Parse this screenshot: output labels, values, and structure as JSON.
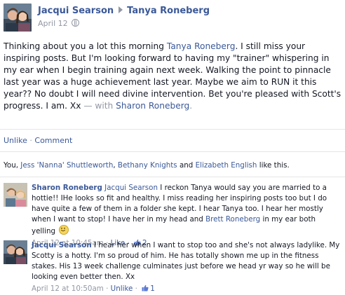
{
  "post": {
    "author": "Jacqui Searson",
    "target": "Tanya Roneberg",
    "date": "April 12",
    "privacy_icon": "globe-icon",
    "text_intro": "Thinking about you a lot this morning ",
    "text_mention": "Tanya Roneberg",
    "text_body": ". I still miss your inspiring posts. But I'm looking forward to having my \"trainer\" whispering in my ear when I begin training again next week. Walking the point to pinnacle last year was a huge achievement last year. Maybe we aim to RUN it this year?? No doubt I will need divine intervention. Bet you're pleased with Scott's progress. I am. Xx",
    "with_text": " — with ",
    "with_name": "Sharon Roneberg",
    "with_end": "."
  },
  "actions": {
    "unlike": "Unlike",
    "separator": "·",
    "comment": "Comment"
  },
  "likes": {
    "prefix": "You, ",
    "name1": "Jess 'Nanna' Shuttleworth",
    "sep1": ", ",
    "name2": "Bethany Knights",
    "and": " and ",
    "name3": "Elizabeth English",
    "suffix": " like this."
  },
  "comments": [
    {
      "author": "Sharon Roneberg",
      "mention1": "Jacqui Searson",
      "text1": " I reckon Tanya would say you are married to a hottie!! IHe looks so fit and healthy. I miss reading her inspiring posts too but I do have quite a few of them in a folder she kept. I hear Tanya too. I hear her mostly when I want to stop! I have her in my head and ",
      "mention2": "Brett Roneberg",
      "text2": " in my ear both yelling ",
      "time": "April 12 at 10:45am",
      "action": "Like",
      "like_count": "2",
      "emoji": "smiley-emoji"
    },
    {
      "author": "Jacqui Searson",
      "text1": " I hear her when I want to stop too and she's not always ladylike. My Scotty is a hotty. I'm so proud of him. He has totally shown me up in the fitness stakes. His 13 week challenge culminates just before we head yr way so he will be looking even better then. Xx",
      "time": "April 12 at 10:50am",
      "action": "Unlike",
      "like_count": "1"
    }
  ],
  "colors": {
    "link": "#3b5998",
    "meta": "#9197a3",
    "text": "#141823",
    "divider": "#e5e5e5"
  }
}
